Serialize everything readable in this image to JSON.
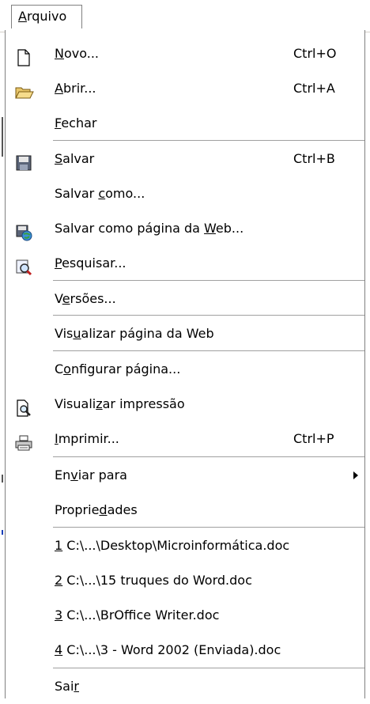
{
  "menu_title": {
    "pre": "",
    "key": "A",
    "post": "rquivo"
  },
  "items": [
    {
      "pre": "",
      "key": "N",
      "post": "ovo...",
      "shortcut": "Ctrl+O",
      "icon": "new-document-icon"
    },
    {
      "pre": "",
      "key": "A",
      "post": "brir...",
      "shortcut": "Ctrl+A",
      "icon": "open-folder-icon"
    },
    {
      "pre": "",
      "key": "F",
      "post": "echar",
      "shortcut": "",
      "icon": ""
    },
    {
      "pre": "",
      "key": "S",
      "post": "alvar",
      "shortcut": "Ctrl+B",
      "icon": "save-disk-icon"
    },
    {
      "pre": "Salvar ",
      "key": "c",
      "post": "omo...",
      "shortcut": "",
      "icon": ""
    },
    {
      "pre": "Salvar como página da ",
      "key": "W",
      "post": "eb...",
      "shortcut": "",
      "icon": "save-web-icon"
    },
    {
      "pre": "",
      "key": "P",
      "post": "esquisar...",
      "shortcut": "",
      "icon": "search-icon"
    },
    {
      "pre": "V",
      "key": "e",
      "post": "rsões...",
      "shortcut": "",
      "icon": ""
    },
    {
      "pre": "Vis",
      "key": "u",
      "post": "alizar página da Web",
      "shortcut": "",
      "icon": ""
    },
    {
      "pre": "C",
      "key": "o",
      "post": "nfigurar página...",
      "shortcut": "",
      "icon": ""
    },
    {
      "pre": "Visuali",
      "key": "z",
      "post": "ar impressão",
      "shortcut": "",
      "icon": "print-preview-icon"
    },
    {
      "pre": "",
      "key": "I",
      "post": "mprimir...",
      "shortcut": "Ctrl+P",
      "icon": "printer-icon"
    },
    {
      "pre": "En",
      "key": "v",
      "post": "iar para",
      "shortcut": "",
      "icon": ""
    },
    {
      "pre": "Proprie",
      "key": "d",
      "post": "ades",
      "shortcut": "",
      "icon": ""
    },
    {
      "pre": "",
      "key": "1",
      "post": " C:\\...\\Desktop\\Microinformática.doc",
      "shortcut": "",
      "icon": ""
    },
    {
      "pre": "",
      "key": "2",
      "post": " C:\\...\\15 truques do Word.doc",
      "shortcut": "",
      "icon": ""
    },
    {
      "pre": "",
      "key": "3",
      "post": " C:\\...\\BrOffice Writer.doc",
      "shortcut": "",
      "icon": ""
    },
    {
      "pre": "",
      "key": "4",
      "post": " C:\\...\\3 - Word 2002 (Enviada).doc",
      "shortcut": "",
      "icon": ""
    },
    {
      "pre": "Sai",
      "key": "r",
      "post": "",
      "shortcut": "",
      "icon": ""
    }
  ]
}
